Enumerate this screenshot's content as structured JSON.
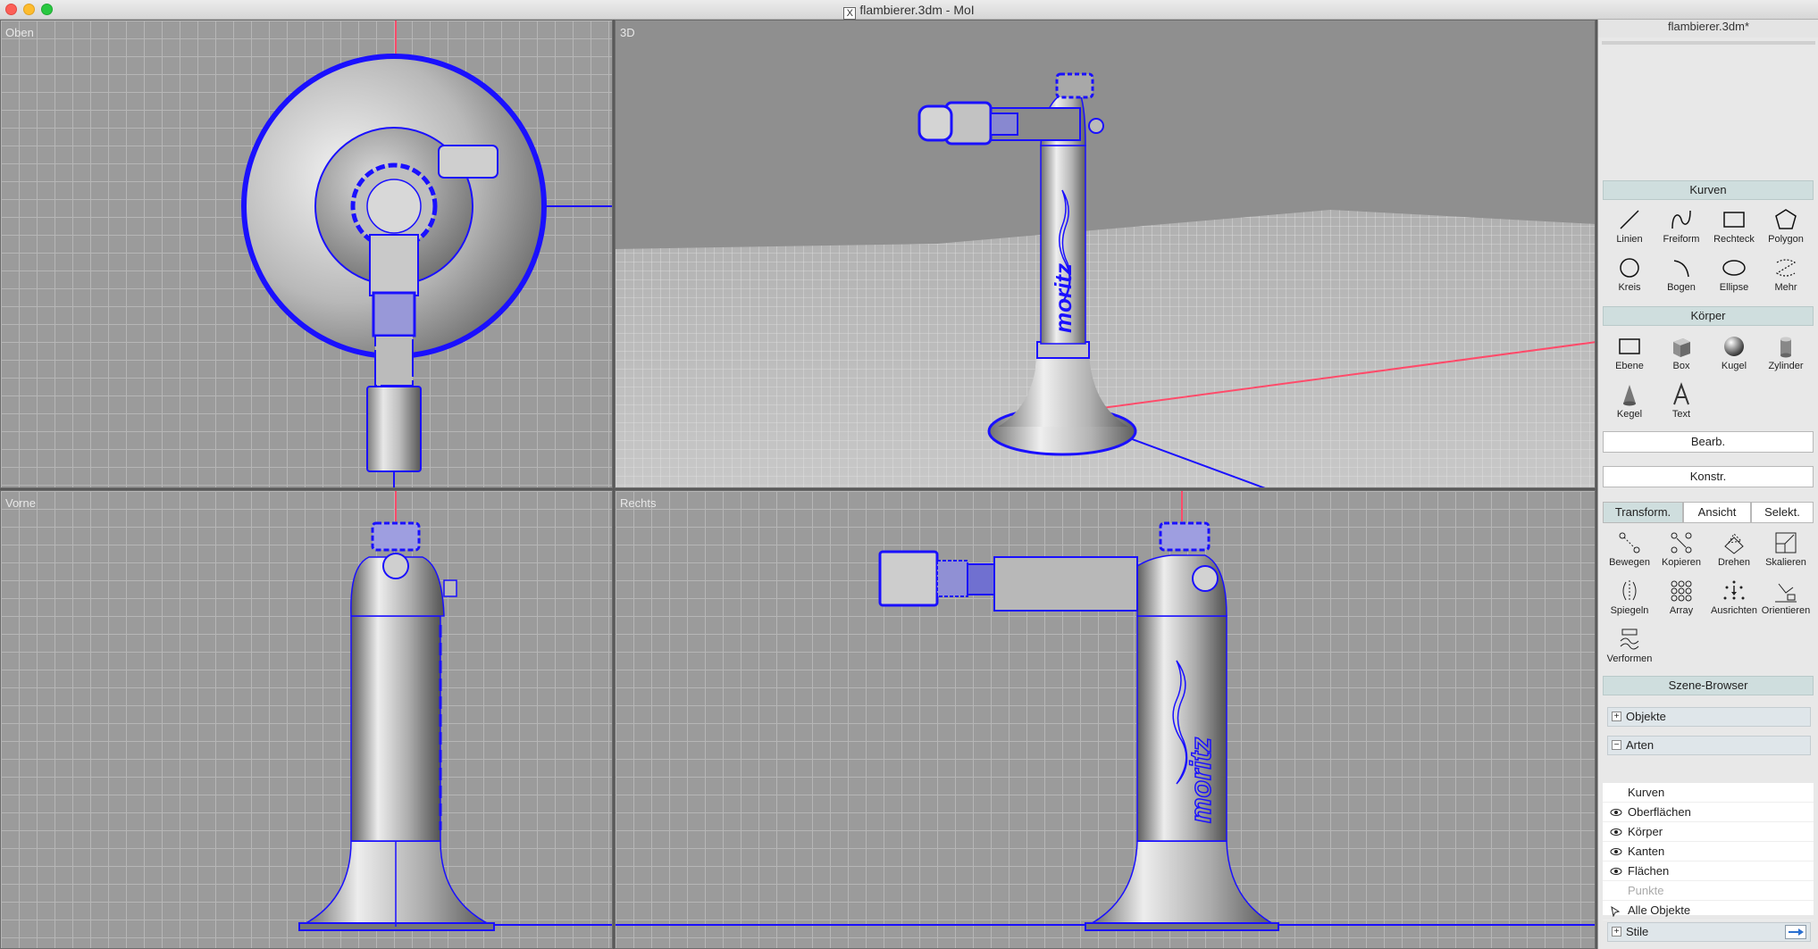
{
  "window": {
    "title": "flambierer.3dm - MoI",
    "x_badge": "X"
  },
  "colors": {
    "accent": "#1a10ff",
    "axis_red": "#ff4b6a",
    "panel_bg": "#e8e8e8",
    "section_bg": "#cfdede"
  },
  "viewports": {
    "top": {
      "label": "Oben"
    },
    "persp": {
      "label": "3D"
    },
    "front": {
      "label": "Vorne"
    },
    "right": {
      "label": "Rechts"
    }
  },
  "panel": {
    "doc_title": "flambierer.3dm*",
    "curves": {
      "header": "Kurven",
      "tools": [
        {
          "label": "Linien",
          "icon": "line-icon"
        },
        {
          "label": "Freiform",
          "icon": "freeform-icon"
        },
        {
          "label": "Rechteck",
          "icon": "rectangle-icon"
        },
        {
          "label": "Polygon",
          "icon": "polygon-icon"
        },
        {
          "label": "Kreis",
          "icon": "circle-icon"
        },
        {
          "label": "Bogen",
          "icon": "arc-icon"
        },
        {
          "label": "Ellipse",
          "icon": "ellipse-icon"
        },
        {
          "label": "Mehr",
          "icon": "more-icon"
        }
      ]
    },
    "solids": {
      "header": "Körper",
      "tools": [
        {
          "label": "Ebene",
          "icon": "plane-icon"
        },
        {
          "label": "Box",
          "icon": "box-icon"
        },
        {
          "label": "Kugel",
          "icon": "sphere-icon"
        },
        {
          "label": "Zylinder",
          "icon": "cylinder-icon"
        },
        {
          "label": "Kegel",
          "icon": "cone-icon"
        },
        {
          "label": "Text",
          "icon": "text-icon"
        }
      ]
    },
    "edit_label": "Bearb.",
    "construct_label": "Konstr.",
    "tabs": [
      {
        "label": "Transform.",
        "active": true
      },
      {
        "label": "Ansicht",
        "active": false
      },
      {
        "label": "Selekt.",
        "active": false
      }
    ],
    "transform_tools": [
      {
        "label": "Bewegen",
        "icon": "move-icon"
      },
      {
        "label": "Kopieren",
        "icon": "copy-icon"
      },
      {
        "label": "Drehen",
        "icon": "rotate-icon"
      },
      {
        "label": "Skalieren",
        "icon": "scale-icon"
      },
      {
        "label": "Spiegeln",
        "icon": "mirror-icon"
      },
      {
        "label": "Array",
        "icon": "array-icon"
      },
      {
        "label": "Ausrichten",
        "icon": "align-icon"
      },
      {
        "label": "Orientieren",
        "icon": "orient-icon"
      },
      {
        "label": "Verformen",
        "icon": "deform-icon"
      }
    ],
    "scene_browser": {
      "header": "Szene-Browser",
      "objects_label": "Objekte",
      "types_label": "Arten",
      "items": [
        {
          "label": "Kurven",
          "visible": false,
          "dim": false
        },
        {
          "label": "Oberflächen",
          "visible": true,
          "dim": false
        },
        {
          "label": "Körper",
          "visible": true,
          "dim": false
        },
        {
          "label": "Kanten",
          "visible": true,
          "dim": false
        },
        {
          "label": "Flächen",
          "visible": true,
          "dim": false
        },
        {
          "label": "Punkte",
          "visible": false,
          "dim": true
        },
        {
          "label": "Alle Objekte",
          "visible": false,
          "dim": false
        }
      ],
      "styles_label": "Stile"
    },
    "text_on_model": "moritz"
  }
}
